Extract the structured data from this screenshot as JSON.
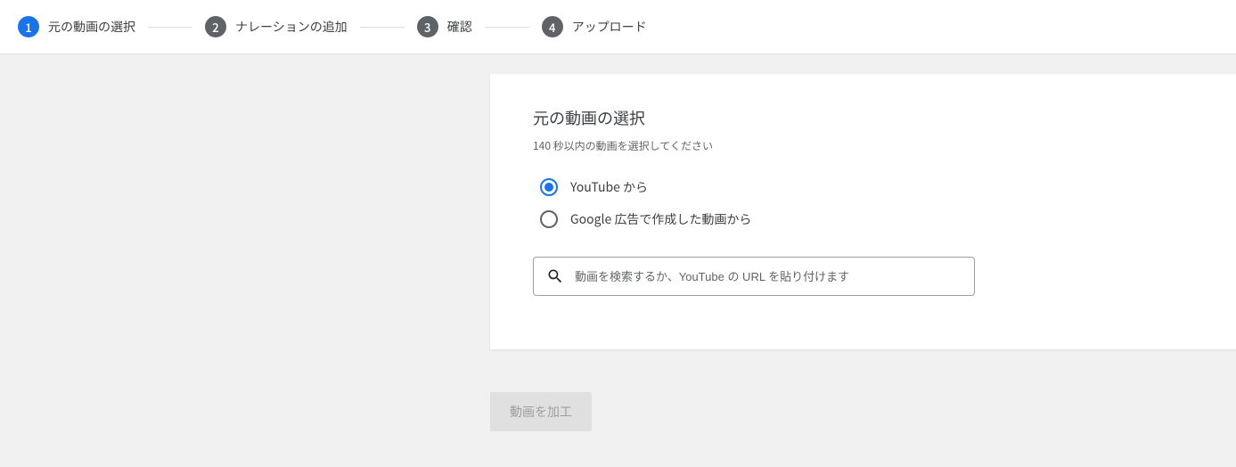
{
  "stepper": {
    "steps": [
      {
        "num": "1",
        "label": "元の動画の選択",
        "active": true
      },
      {
        "num": "2",
        "label": "ナレーションの追加",
        "active": false
      },
      {
        "num": "3",
        "label": "確認",
        "active": false
      },
      {
        "num": "4",
        "label": "アップロード",
        "active": false
      }
    ]
  },
  "card": {
    "title": "元の動画の選択",
    "subtitle": "140 秒以内の動画を選択してください",
    "options": {
      "youtube": "YouTube から",
      "google_ads": "Google 広告で作成した動画から"
    },
    "search_placeholder": "動画を検索するか、YouTube の URL を貼り付けます"
  },
  "action": {
    "primary": "動画を加工"
  }
}
